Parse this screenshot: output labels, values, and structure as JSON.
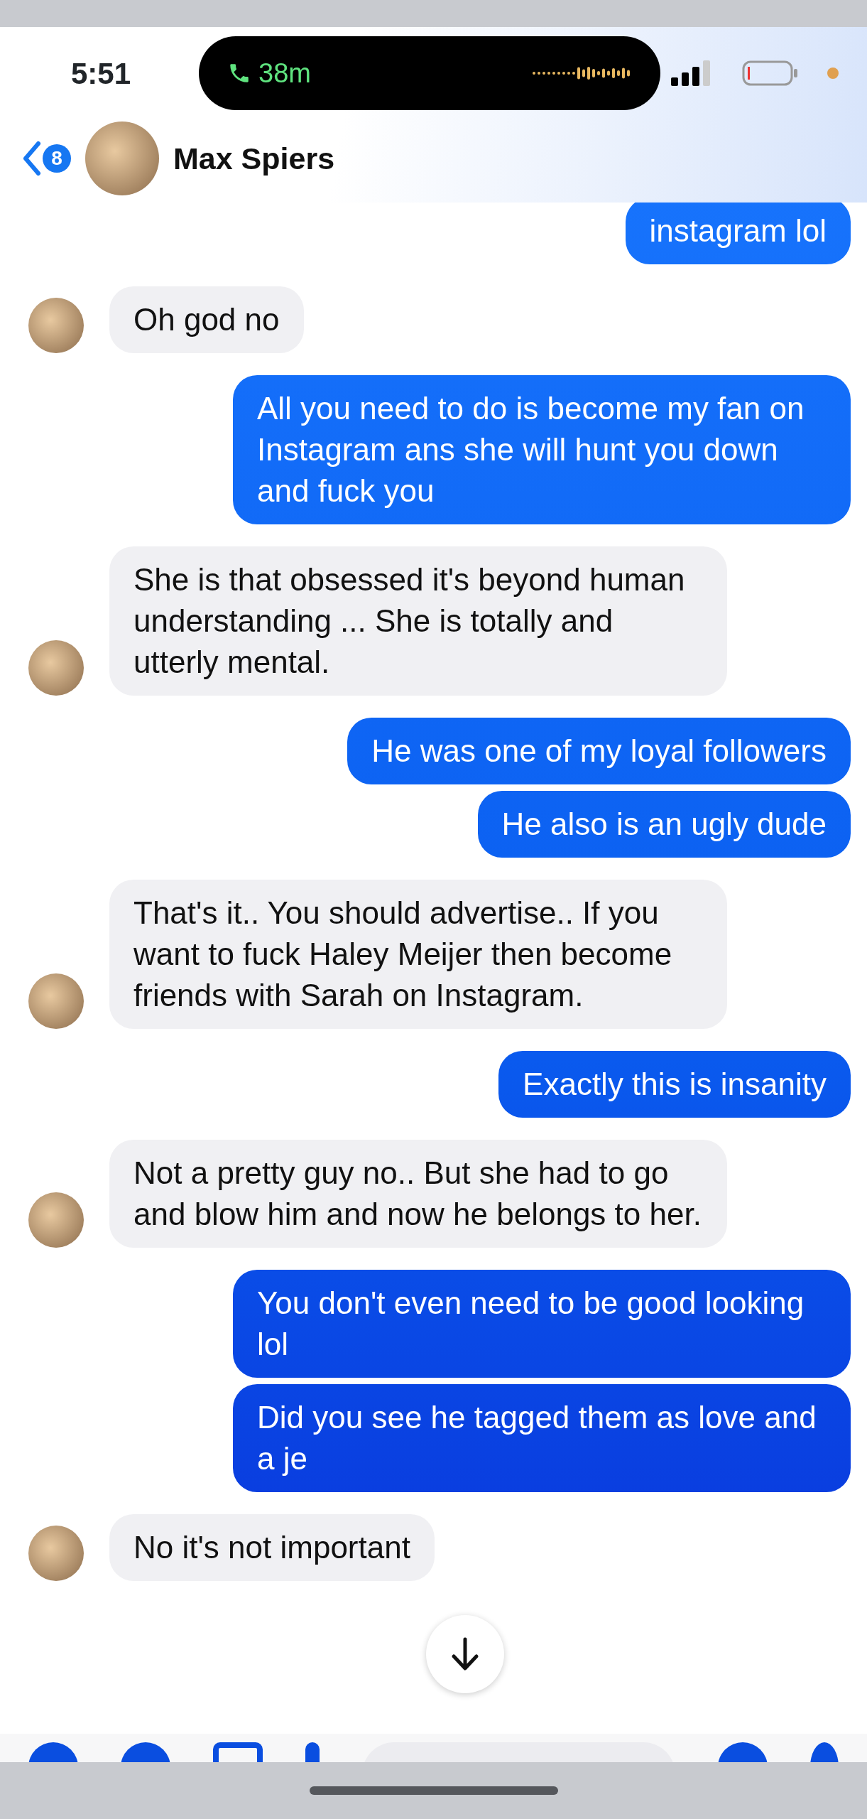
{
  "status_bar": {
    "time": "5:51",
    "call_duration": "38m"
  },
  "header": {
    "unread_count": "8",
    "contact_name": "Max Spiers"
  },
  "messages": [
    {
      "kind": "sent",
      "text": "instagram lol"
    },
    {
      "kind": "received",
      "text": "Oh god no"
    },
    {
      "kind": "sent",
      "text": "All you need to do is become my fan on Instagram ans she will hunt you down and fuck you"
    },
    {
      "kind": "received",
      "text": "She is that obsessed it's beyond human understanding ... She is totally and utterly mental."
    },
    {
      "kind": "sent",
      "text": "He was one of my loyal followers"
    },
    {
      "kind": "sent",
      "text": "He also is an ugly dude"
    },
    {
      "kind": "received",
      "text": "That's it.. You should advertise.. If you want to fuck Haley Meijer then become friends with Sarah on Instagram."
    },
    {
      "kind": "sent",
      "text": "Exactly this is insanity"
    },
    {
      "kind": "received",
      "text": "Not a pretty guy no.. But she had to go and blow him and now he belongs to her."
    },
    {
      "kind": "sent",
      "text": "You don't even need to be good looking lol"
    },
    {
      "kind": "sent",
      "text": "Did you see he tagged them as love and a je"
    },
    {
      "kind": "received",
      "text": "No it's not important"
    }
  ]
}
